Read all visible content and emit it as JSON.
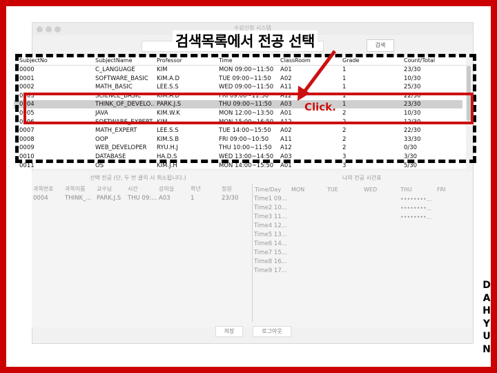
{
  "window": {
    "title": "수강신청 시스템"
  },
  "search": {
    "button_label": "검색"
  },
  "banner": "검색목록에서 전공 선택",
  "callout": "Click.",
  "table": {
    "columns": [
      "SubjectNo",
      "SubjectName",
      "Professor",
      "Time",
      "ClassRoom",
      "Grade",
      "Count/Total"
    ],
    "rows": [
      [
        "0000",
        "C_LANGUAGE",
        "KIM",
        "MON 09:00~11:50",
        "A01",
        "1",
        "23/30"
      ],
      [
        "0001",
        "SOFTWARE_BASIC",
        "KIM.A.D",
        "TUE 09:00~11:50",
        "A02",
        "1",
        "10/30"
      ],
      [
        "0002",
        "MATH_BASIC",
        "LEE.S.S",
        "WED 09:00~11:50",
        "A11",
        "1",
        "25/30"
      ],
      [
        "0003",
        "SCIENCE_BASIC",
        "KIM.A.D",
        "FRI 09:00~11:50",
        "A12",
        "1",
        "22/30"
      ],
      [
        "0004",
        "THINK_OF_DEVELO...",
        "PARK.J.S",
        "THU 09:00~11:50",
        "A03",
        "1",
        "23/30"
      ],
      [
        "0005",
        "JAVA",
        "KIM.W.K",
        "MON 12:00~13:50",
        "A01",
        "2",
        "10/30"
      ],
      [
        "0006",
        "SOFTWARE_EXPERT",
        "KIM",
        "MON 15:00~16:50",
        "A12",
        "2",
        "12/30"
      ],
      [
        "0007",
        "MATH_EXPERT",
        "LEE.S.S",
        "TUE 14:00~15:50",
        "A02",
        "2",
        "22/30"
      ],
      [
        "0008",
        "OOP",
        "KIM.S.B",
        "FRI 09:00~10:50",
        "A11",
        "2",
        "33/30"
      ],
      [
        "0009",
        "WEB_DEVELOPER",
        "RYU.H.J",
        "THU 10:00~11:50",
        "A12",
        "2",
        "0/30"
      ],
      [
        "0010",
        "DATABASE",
        "HA.D.S",
        "WED 13:00~14:50",
        "A03",
        "3",
        "3/30"
      ],
      [
        "0011",
        "OS",
        "KIM.J.H",
        "MON 14:00~15:50",
        "A01",
        "3",
        "5/30"
      ]
    ],
    "selected_index": 4
  },
  "selected_pane": {
    "title": "선택 전공 (단, 두 번 클릭 시 취소됩니다.)",
    "columns": [
      "과목번호",
      "과목이름",
      "교수님",
      "시간",
      "강의실",
      "학년",
      "정원"
    ],
    "row": [
      "0004",
      "THINK_...",
      "PARK.J.S",
      "THU 09:...",
      "A03",
      "1",
      "23/30"
    ]
  },
  "timetable": {
    "title": "나의 전공 시간표",
    "days": [
      "Time/Day",
      "MON",
      "TUE",
      "WED",
      "THU",
      "FRI"
    ],
    "times": [
      "Time1 09...",
      "Time2 10...",
      "Time3 11...",
      "Time4 12...",
      "Time5 13...",
      "Time6 14...",
      "Time7 15...",
      "Time8 16...",
      "Time9 17..."
    ],
    "thu_cells": [
      "••••••••...",
      "••••••••...",
      "••••••••..."
    ]
  },
  "buttons": {
    "save": "저장",
    "logout": "로그아웃"
  },
  "signature": [
    "D",
    "A",
    "H",
    "Y",
    "U",
    "N"
  ],
  "colors": {
    "frame": "#cc0000",
    "selection": "#cfcfcf",
    "accent": "#cc1010"
  }
}
